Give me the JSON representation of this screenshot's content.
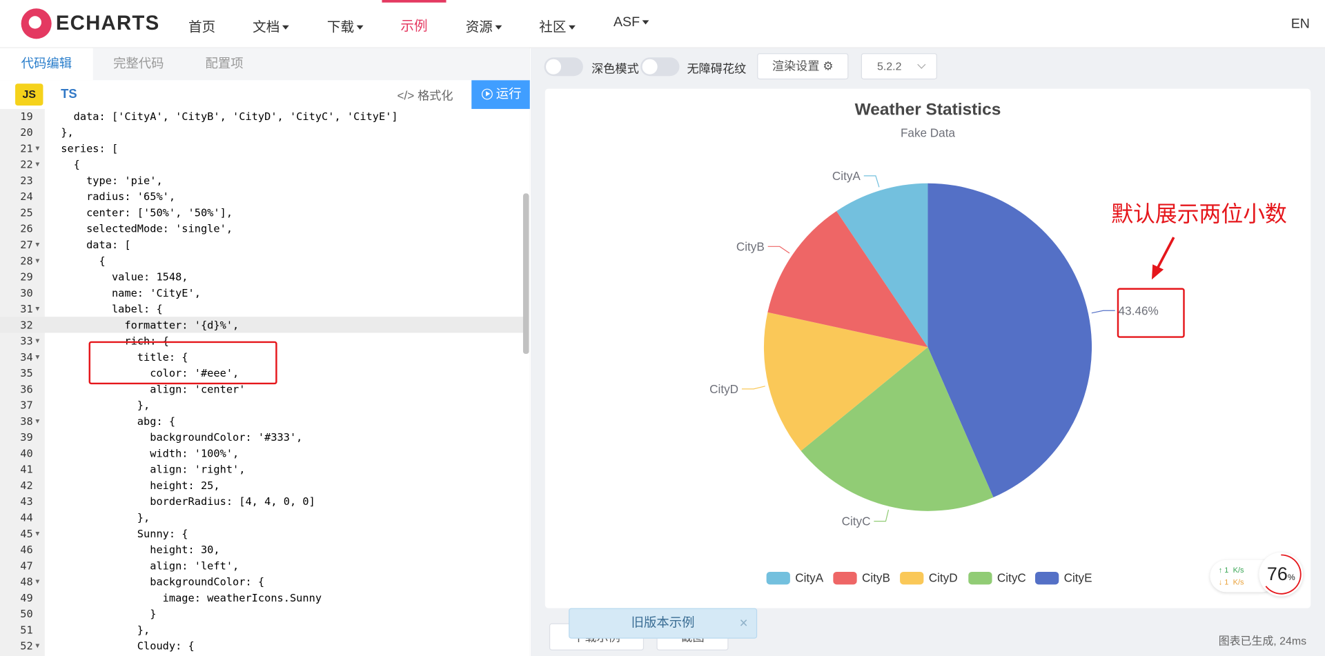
{
  "nav": {
    "logo_text": "ECHARTS",
    "items": [
      "首页",
      "文档",
      "下载",
      "示例",
      "资源",
      "社区",
      "ASF"
    ],
    "lang": "EN"
  },
  "editor_tabs": [
    "代码编辑",
    "完整代码",
    "配置项"
  ],
  "lang_tabs": {
    "js": "JS",
    "ts": "TS"
  },
  "format_label": "格式化",
  "format_icon": "code-icon",
  "run_label": "运行",
  "code_lines": [
    {
      "n": "19",
      "t": "    data: ['CityA', 'CityB', 'CityD', 'CityC', 'CityE']"
    },
    {
      "n": "20",
      "t": "  },"
    },
    {
      "n": "21",
      "t": "  series: [",
      "fold": true
    },
    {
      "n": "22",
      "t": "    {",
      "fold": true
    },
    {
      "n": "23",
      "t": "      type: 'pie',"
    },
    {
      "n": "24",
      "t": "      radius: '65%',"
    },
    {
      "n": "25",
      "t": "      center: ['50%', '50%'],"
    },
    {
      "n": "26",
      "t": "      selectedMode: 'single',"
    },
    {
      "n": "27",
      "t": "      data: [",
      "fold": true
    },
    {
      "n": "28",
      "t": "        {",
      "fold": true
    },
    {
      "n": "29",
      "t": "          value: 1548,"
    },
    {
      "n": "30",
      "t": "          name: 'CityE',"
    },
    {
      "n": "31",
      "t": "          label: {",
      "fold": true
    },
    {
      "n": "32",
      "t": "            formatter: '{d}%',"
    },
    {
      "n": "33",
      "t": "            rich: {",
      "fold": true
    },
    {
      "n": "34",
      "t": "              title: {",
      "fold": true
    },
    {
      "n": "35",
      "t": "                color: '#eee',"
    },
    {
      "n": "36",
      "t": "                align: 'center'"
    },
    {
      "n": "37",
      "t": "              },"
    },
    {
      "n": "38",
      "t": "              abg: {",
      "fold": true
    },
    {
      "n": "39",
      "t": "                backgroundColor: '#333',"
    },
    {
      "n": "40",
      "t": "                width: '100%',"
    },
    {
      "n": "41",
      "t": "                align: 'right',"
    },
    {
      "n": "42",
      "t": "                height: 25,"
    },
    {
      "n": "43",
      "t": "                borderRadius: [4, 4, 0, 0]"
    },
    {
      "n": "44",
      "t": "              },"
    },
    {
      "n": "45",
      "t": "              Sunny: {",
      "fold": true
    },
    {
      "n": "46",
      "t": "                height: 30,"
    },
    {
      "n": "47",
      "t": "                align: 'left',"
    },
    {
      "n": "48",
      "t": "                backgroundColor: {",
      "fold": true
    },
    {
      "n": "49",
      "t": "                  image: weatherIcons.Sunny"
    },
    {
      "n": "50",
      "t": "                }"
    },
    {
      "n": "51",
      "t": "              },"
    },
    {
      "n": "52",
      "t": "              Cloudy: {",
      "fold": true
    }
  ],
  "toolbar": {
    "dark_mode": "深色模式",
    "aria": "无障碍花纹",
    "render_settings": "渲染设置",
    "version": "5.2.2"
  },
  "chart_data": {
    "type": "pie",
    "title": "Weather Statistics",
    "subtitle": "Fake Data",
    "legend_placement": "bottom",
    "slices": [
      {
        "name": "CityE",
        "value": 1548,
        "color": "#5470c6",
        "label": "43.46%"
      },
      {
        "name": "CityC",
        "value": 735,
        "color": "#91cc75",
        "label": "CityC"
      },
      {
        "name": "CityD",
        "value": 510,
        "color": "#fac858",
        "label": "CityD"
      },
      {
        "name": "CityB",
        "value": 434,
        "color": "#ee6666",
        "label": "CityB"
      },
      {
        "name": "CityA",
        "value": 335,
        "color": "#73c0de",
        "label": "CityA"
      }
    ],
    "legend": [
      {
        "name": "CityA",
        "color": "#73c0de"
      },
      {
        "name": "CityB",
        "color": "#ee6666"
      },
      {
        "name": "CityD",
        "color": "#fac858"
      },
      {
        "name": "CityC",
        "color": "#91cc75"
      },
      {
        "name": "CityE",
        "color": "#5470c6"
      }
    ]
  },
  "annotation": "默认展示两位小数",
  "net": {
    "up": "1",
    "down": "1",
    "unit": "K/s",
    "percent": "76",
    "percent_sign": "%"
  },
  "bottom": {
    "download_label": "下载示例",
    "screenshot_label": "截图",
    "old_version": "旧版本示例",
    "status": "图表已生成, 24ms"
  }
}
